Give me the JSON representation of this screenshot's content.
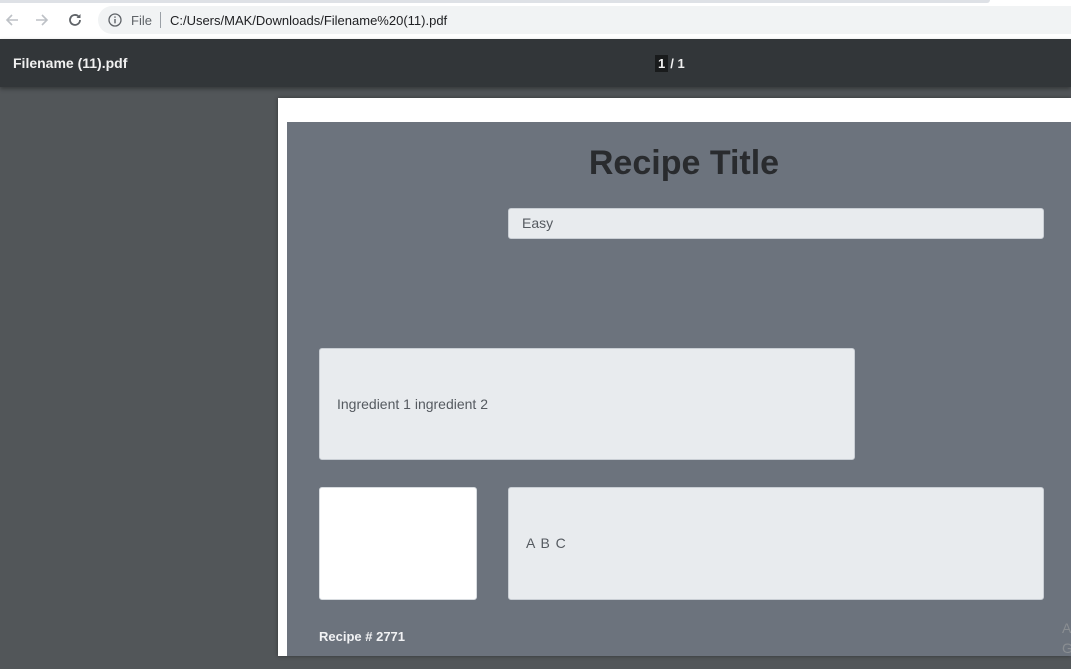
{
  "browser": {
    "scheme_label": "File",
    "url": "C:/Users/MAK/Downloads/Filename%20(11).pdf",
    "icons": {
      "back": "arrow-left",
      "forward": "arrow-right",
      "reload": "reload",
      "site_info": "info-circle"
    }
  },
  "pdf_viewer": {
    "file_name": "Filename (11).pdf",
    "page_current": "1",
    "page_total": "/ 1"
  },
  "document": {
    "recipe_title": "Recipe Title",
    "difficulty": "Easy",
    "ingredients": "Ingredient 1 ingredient 2",
    "steps": "A B C",
    "recipe_number": "Recipe # 2771"
  },
  "colors": {
    "toolbar_bg": "#323639",
    "viewer_bg": "#525659",
    "card_bg": "#6c737d",
    "field_bg": "#e8ebee"
  }
}
